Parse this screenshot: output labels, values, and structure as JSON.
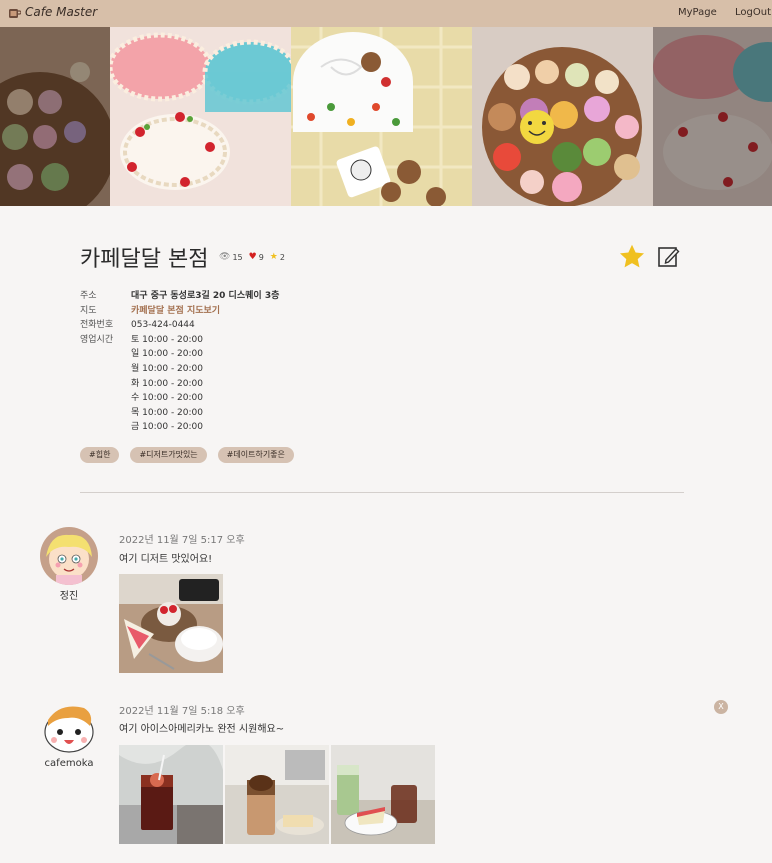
{
  "brand": {
    "name": "Cafe Master",
    "icon": "coffee-cup-icon"
  },
  "nav": {
    "mypage": "MyPage",
    "logout": "LogOut"
  },
  "store": {
    "name": "카페달달 본점",
    "views": "15",
    "likes": "9",
    "rating": "2",
    "info": [
      {
        "label": "주소",
        "value": "대구 중구 동성로3길 20 디스퀘이 3층"
      },
      {
        "label": "지도",
        "value": "카페달달 본점 지도보기"
      },
      {
        "label": "전화번호",
        "value": "053-424-0444"
      },
      {
        "label": "영업시간",
        "value": "토 10:00 - 20:00"
      }
    ],
    "hours": [
      "일 10:00 - 20:00",
      "월 10:00 - 20:00",
      "화 10:00 - 20:00",
      "수 10:00 - 20:00",
      "목 10:00 - 20:00",
      "금 10:00 - 20:00"
    ],
    "tags": [
      "#힙한",
      "#디저트가맛있는",
      "#데이트하기좋은"
    ]
  },
  "reviews": [
    {
      "user": "정진",
      "date": "2022년 11월 7일 5:17 오후",
      "text": "여기 디저트 맛있어요!"
    },
    {
      "user": "cafemoka",
      "date": "2022년 11월 7일 5:18 오후",
      "text": "여기 아이스아메리카노 완전 시원해요~",
      "delete": "X"
    }
  ],
  "colors": {
    "navbar": "#d7bfa9",
    "tag_bg": "#d6c2b3",
    "link": "#a3704f",
    "star": "#f0c020",
    "heart": "#d42020"
  }
}
